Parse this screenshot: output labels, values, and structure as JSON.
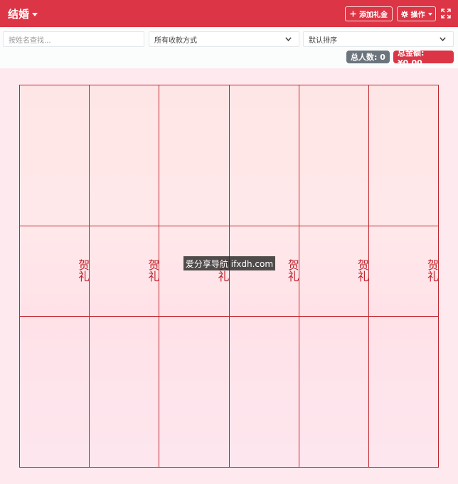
{
  "header": {
    "title": "结婚",
    "add_button": "添加礼金",
    "ops_button": "操作"
  },
  "filters": {
    "search_placeholder": "按姓名查找...",
    "method_value": "所有收款方式",
    "sort_value": "默认排序"
  },
  "stats": {
    "people_label": "总人数: 0",
    "amount_label": "总金额: ¥0.00"
  },
  "cards": [
    {
      "text": "贺礼"
    },
    {
      "text": "贺礼"
    },
    {
      "text": "贺礼"
    },
    {
      "text": "贺礼"
    },
    {
      "text": "贺礼"
    },
    {
      "text": "贺礼"
    }
  ],
  "watermark": "爱分享导航 ifxdh.com",
  "colors": {
    "primary": "#dc3545",
    "secondary": "#6c757d",
    "card_border": "#c0262e"
  }
}
